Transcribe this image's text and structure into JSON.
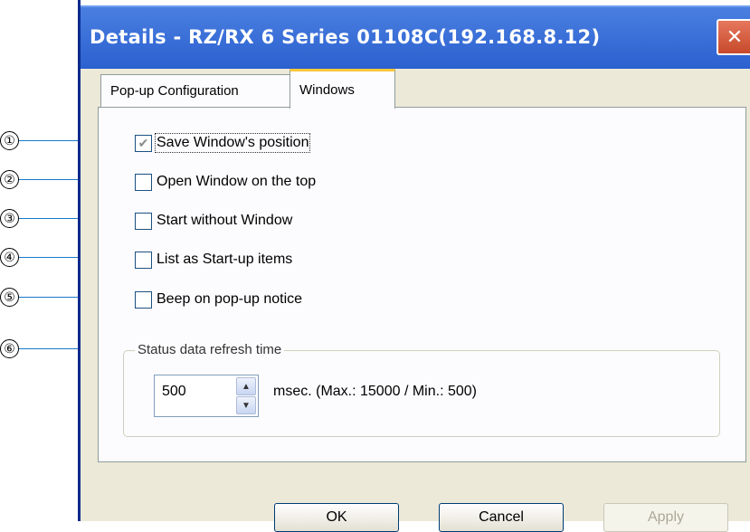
{
  "window": {
    "title": "Details - RZ/RX 6 Series 01108C(192.168.8.12)",
    "close_glyph": "✕"
  },
  "tabs": [
    {
      "label": "Pop-up Configuration",
      "active": false
    },
    {
      "label": "Windows",
      "active": true
    }
  ],
  "options": [
    {
      "label": "Save Window's position",
      "checked": true
    },
    {
      "label": "Open Window on the top",
      "checked": false
    },
    {
      "label": "Start without Window",
      "checked": false
    },
    {
      "label": "List as Start-up items",
      "checked": false
    },
    {
      "label": "Beep on pop-up notice",
      "checked": false
    }
  ],
  "refresh": {
    "group_title": "Status data refresh time",
    "value": "500",
    "unit_label": "msec. (Max.: 15000 / Min.: 500)"
  },
  "buttons": {
    "ok": "OK",
    "cancel": "Cancel",
    "apply": "Apply"
  },
  "callouts": [
    "①",
    "②",
    "③",
    "④",
    "⑤",
    "⑥"
  ],
  "colors": {
    "titlebar": "#2a5fcf",
    "dialog_bg": "#ece9d8",
    "active_tab_accent": "#ffc83c",
    "callout_line": "#1a7ac8"
  }
}
